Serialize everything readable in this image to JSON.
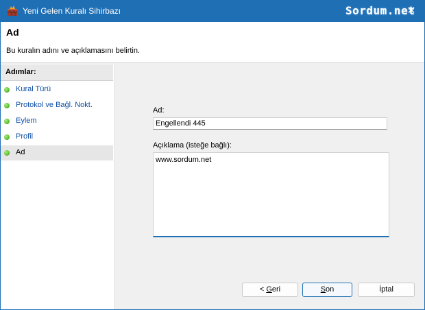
{
  "window": {
    "title": "Yeni Gelen Kuralı Sihirbazı",
    "brand": "Sordum.net",
    "close_symbol": "✕"
  },
  "header": {
    "title": "Ad",
    "description": "Bu kuralın adını ve açıklamasını belirtin."
  },
  "sidebar": {
    "title": "Adımlar:",
    "items": [
      {
        "label": "Kural Türü"
      },
      {
        "label": "Protokol ve Bağl. Nokt."
      },
      {
        "label": "Eylem"
      },
      {
        "label": "Profil"
      },
      {
        "label": "Ad"
      }
    ],
    "active_index": 4
  },
  "form": {
    "name_label": "Ad:",
    "name_value": "Engellendi 445",
    "desc_label": "Açıklama (isteğe bağlı):",
    "desc_value": "www.sordum.net"
  },
  "buttons": {
    "back_prefix": "< ",
    "back_key": "G",
    "back_rest": "eri",
    "finish_key": "S",
    "finish_rest": "on",
    "cancel_label": "İptal"
  },
  "colors": {
    "accent": "#1f6fb5",
    "step_link": "#0b4ea2",
    "step_dot": "#2e9a0c"
  },
  "icons": {
    "app": "firewall-icon",
    "close": "close-icon",
    "step": "green-dot-icon"
  }
}
